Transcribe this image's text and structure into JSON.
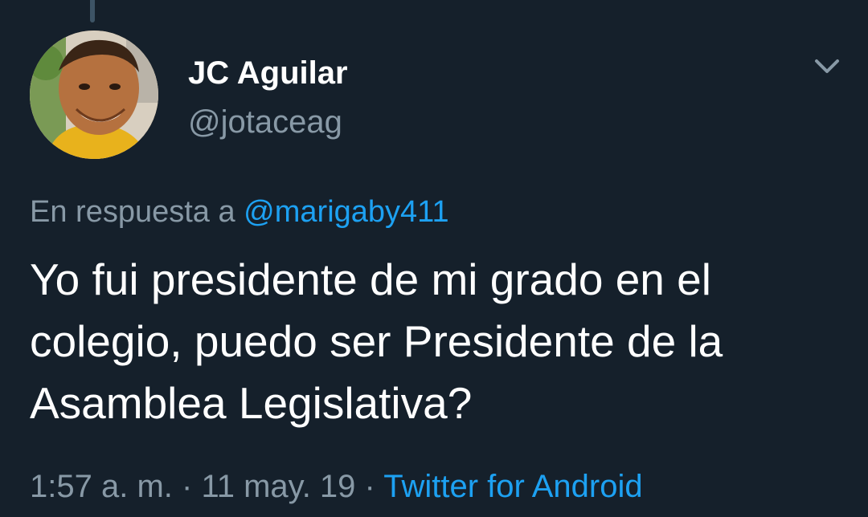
{
  "author": {
    "display_name": "JC Aguilar",
    "handle": "@jotaceag"
  },
  "reply": {
    "prefix": "En respuesta a",
    "mention": "@marigaby411"
  },
  "tweet": {
    "text": "Yo fui presidente de mi grado en el colegio, puedo ser Presidente de la Asamblea Legislativa?"
  },
  "meta": {
    "time": "1:57 a. m.",
    "separator": "·",
    "date": "11 may. 19",
    "source": "Twitter for Android"
  },
  "icons": {
    "avatar": "user-avatar-photo",
    "caret": "chevron-down-icon"
  },
  "colors": {
    "background": "#15202b",
    "primary_text": "#ffffff",
    "secondary_text": "#8899a6",
    "link": "#1da1f2"
  }
}
